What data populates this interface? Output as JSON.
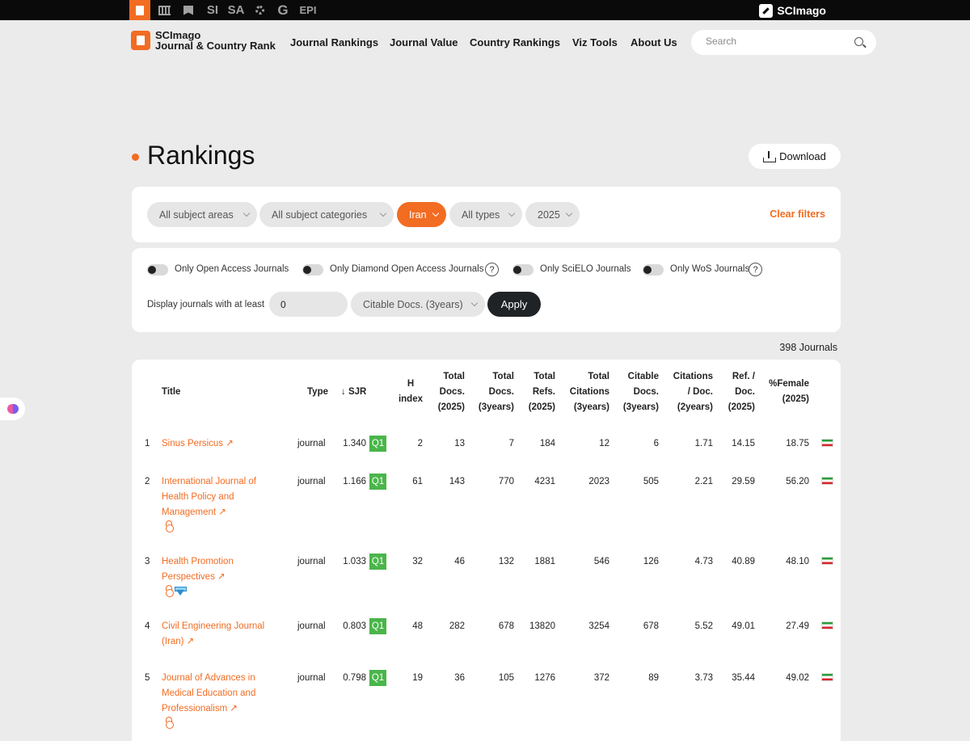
{
  "topbar": {
    "items": [
      "SI",
      "SA",
      "EPI"
    ],
    "brand": "SCImago"
  },
  "header": {
    "logo_line1": "SCImago",
    "logo_line2": "Journal & Country Rank",
    "nav": [
      "Journal Rankings",
      "Journal Value",
      "Country Rankings",
      "Viz Tools",
      "About Us"
    ],
    "search_placeholder": "Search"
  },
  "page": {
    "title": "Rankings",
    "download_label": "Download"
  },
  "filters": {
    "subject_areas": "All subject areas",
    "subject_categories": "All subject categories",
    "country": "Iran",
    "types": "All types",
    "year": "2025",
    "clear": "Clear filters"
  },
  "options": {
    "open_access": "Only Open Access Journals",
    "diamond": "Only Diamond Open Access Journals",
    "scielo": "Only SciELO Journals",
    "wos": "Only WoS Journals",
    "help": "?",
    "min_label": "Display journals with at least",
    "min_value": "0",
    "min_field": "Citable Docs. (3years)",
    "apply": "Apply"
  },
  "count_text": "398  Journals",
  "table": {
    "headers": {
      "title": "Title",
      "type": "Type",
      "sjr": "↓ SJR",
      "h1": "H",
      "h2": "index",
      "td1": "Total",
      "td2": "Docs.",
      "td3": "(2025)",
      "t3y1": "Total",
      "t3y2": "Docs.",
      "t3y3": "(3years)",
      "tr1": "Total",
      "tr2": "Refs.",
      "tr3": "(2025)",
      "tc1": "Total",
      "tc2": "Citations",
      "tc3": "(3years)",
      "cd1": "Citable",
      "cd2": "Docs.",
      "cd3": "(3years)",
      "cpd1": "Citations",
      "cpd2": "/ Doc.",
      "cpd3": "(2years)",
      "rpd1": "Ref. /",
      "rpd2": "Doc.",
      "rpd3": "(2025)",
      "fem1": "%Female",
      "fem2": "(2025)"
    },
    "rows": [
      {
        "rank": "1",
        "title": [
          "Sinus Persicus ↗"
        ],
        "type": "journal",
        "sjr": "1.340",
        "q": "Q1",
        "h": "2",
        "docs": "13",
        "docs3": "7",
        "refs": "184",
        "cites3": "12",
        "citable3": "6",
        "cpd": "1.71",
        "rpd": "14.15",
        "female": "18.75"
      },
      {
        "rank": "2",
        "title": [
          "International Journal of",
          "Health Policy and",
          "Management ↗"
        ],
        "type": "journal",
        "sjr": "1.166",
        "q": "Q1",
        "h": "61",
        "docs": "143",
        "docs3": "770",
        "refs": "4231",
        "cites3": "2023",
        "citable3": "505",
        "cpd": "2.21",
        "rpd": "29.59",
        "female": "56.20"
      },
      {
        "rank": "3",
        "title": [
          "Health Promotion",
          "Perspectives ↗"
        ],
        "type": "journal",
        "sjr": "1.033",
        "q": "Q1",
        "h": "32",
        "docs": "46",
        "docs3": "132",
        "refs": "1881",
        "cites3": "546",
        "citable3": "126",
        "cpd": "4.73",
        "rpd": "40.89",
        "female": "48.10"
      },
      {
        "rank": "4",
        "title": [
          "Civil Engineering Journal",
          "(Iran) ↗"
        ],
        "type": "journal",
        "sjr": "0.803",
        "q": "Q1",
        "h": "48",
        "docs": "282",
        "docs3": "678",
        "refs": "13820",
        "cites3": "3254",
        "citable3": "678",
        "cpd": "5.52",
        "rpd": "49.01",
        "female": "27.49"
      },
      {
        "rank": "5",
        "title": [
          "Journal of Advances in",
          "Medical Education and",
          "Professionalism ↗"
        ],
        "type": "journal",
        "sjr": "0.798",
        "q": "Q1",
        "h": "19",
        "docs": "36",
        "docs3": "105",
        "refs": "1276",
        "cites3": "372",
        "citable3": "89",
        "cpd": "3.73",
        "rpd": "35.44",
        "female": "49.02"
      }
    ]
  },
  "colors": {
    "accent": "#f26c22",
    "q1": "#4ab54a",
    "dark": "#1f2326"
  }
}
